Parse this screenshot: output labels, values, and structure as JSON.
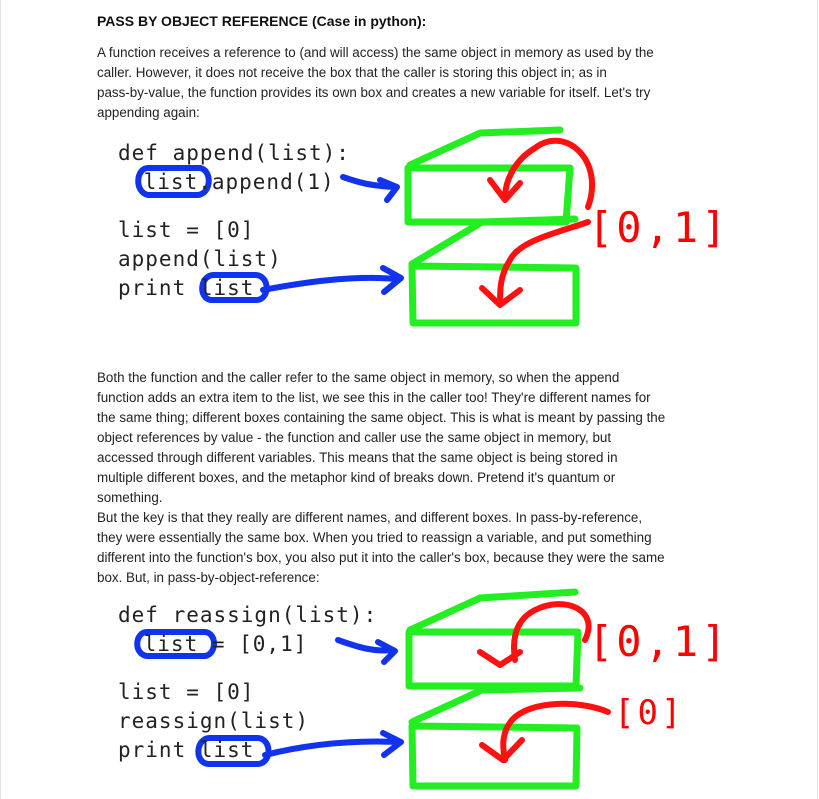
{
  "heading": "PASS BY OBJECT REFERENCE (Case in python):",
  "intro_lines": [
    "A function receives a reference to (and will access) the same object in memory as used by the",
    "caller. However, it does not receive the box that the caller is storing this object in; as in",
    "pass-by-value, the function provides its own box and creates a new variable for itself. Let's try",
    "appending again:"
  ],
  "figure1": {
    "code_def": "def append(list):",
    "code_body": " list.append(1)",
    "code_assign": "list = [0]",
    "code_call": "append(list)",
    "code_print": "print list",
    "value_label": "[0,1]"
  },
  "body_lines": [
    "Both the function and the caller refer to the same object in memory, so when the append",
    "function adds an extra item to the list, we see this in the caller too! They're different names for",
    "the same thing; different boxes containing the same object. This is what is meant by passing the",
    "object references by value - the function and caller use the same object in memory, but",
    "accessed through different variables. This means that the same object is being stored in",
    "multiple different boxes, and the metaphor kind of breaks down. Pretend it's quantum or",
    "something.",
    "But the key is that they really are different names, and different boxes. In pass-by-reference,",
    "they were essentially the same box. When you tried to reassign a variable, and put something",
    "different into the function's box, you also put it into the caller's box, because they were the same",
    "box. But, in pass-by-object-reference:"
  ],
  "figure2": {
    "code_def": "def reassign(list):",
    "code_body": " list = [0,1]",
    "code_assign": "list = [0]",
    "code_call": "reassign(list)",
    "code_print": "print list",
    "value_label_top": "[0,1]",
    "value_label_bottom": "[0]"
  },
  "colors": {
    "green": "#22ee22",
    "red": "#ff1111",
    "blue": "#1133ee"
  }
}
